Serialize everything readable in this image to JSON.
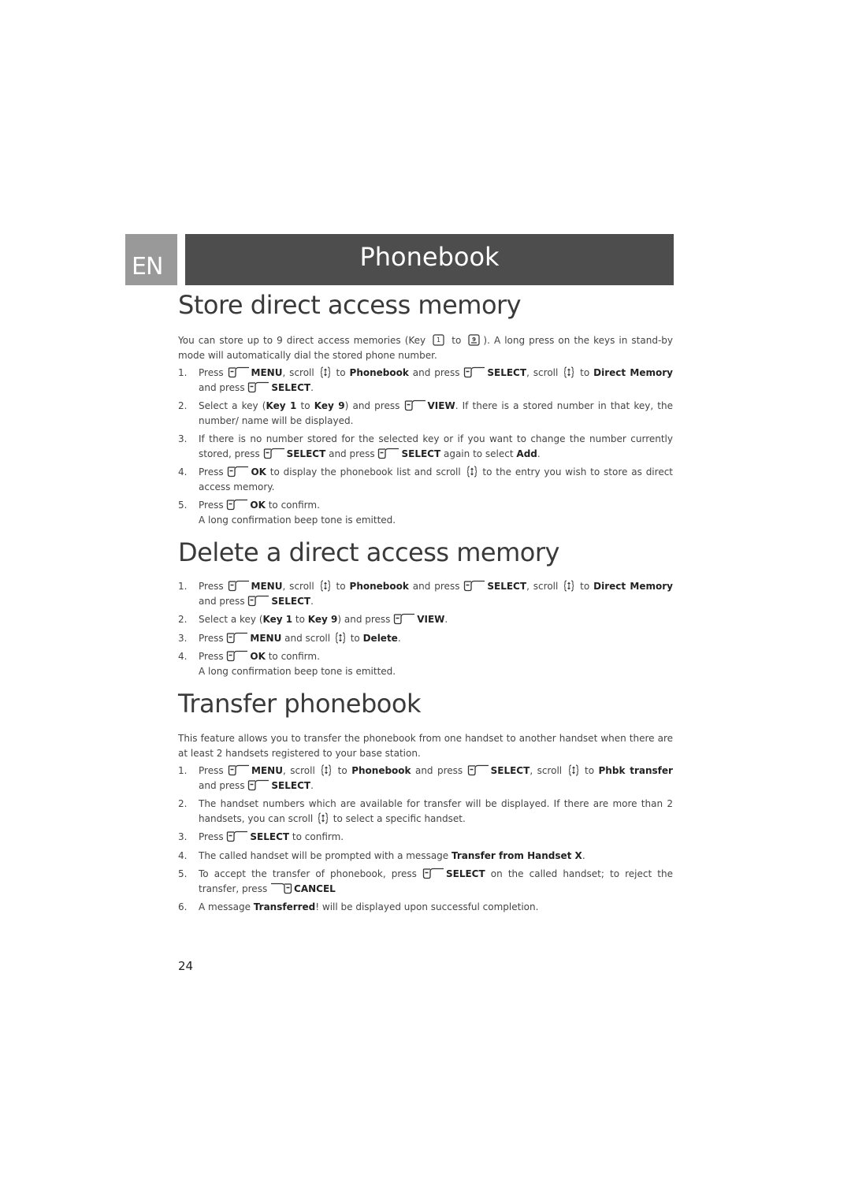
{
  "header": {
    "lang": "EN",
    "title": "Phonebook"
  },
  "sections": [
    {
      "title": "Store direct access memory",
      "intro": {
        "a": "You can store up to 9 direct access memories (Key",
        "to": "to",
        "b": "). A long press on the keys in stand-by mode will automatically dial the stored phone number.",
        "key_first": "1-key-icon",
        "key_last": "9-key-icon"
      },
      "steps": [
        {
          "n": "1.",
          "parts": [
            "Press ",
            "{L}",
            "MENU",
            ", scroll ",
            "{N}",
            " to ",
            "Phonebook",
            " and press ",
            "{L}",
            "SELECT",
            ", scroll ",
            "{N}",
            " to ",
            "Direct Memory",
            " and press ",
            "{L}",
            "SELECT",
            "."
          ]
        },
        {
          "n": "2.",
          "parts": [
            "Select a key (",
            "Key 1",
            " to ",
            "Key 9",
            ") and press ",
            "{L}",
            "VIEW",
            ". If there is a stored number in that key, the number/ name will be displayed."
          ]
        },
        {
          "n": "3.",
          "parts": [
            "If there is no number stored for the selected key or if you want to change the number currently stored, press ",
            "{L}",
            "SELECT",
            " and press ",
            "{L}",
            "SELECT",
            " again to select ",
            "Add",
            "."
          ]
        },
        {
          "n": "4.",
          "parts": [
            "Press ",
            "{L}",
            "OK",
            " to display the phonebook list and scroll ",
            "{N}",
            " to the entry you wish to store as direct access memory."
          ]
        },
        {
          "n": "5.",
          "parts": [
            "Press ",
            "{L}",
            "OK",
            " to confirm.",
            "{BR}",
            "A long confirmation beep tone is emitted."
          ]
        }
      ]
    },
    {
      "title": "Delete a direct access memory",
      "steps": [
        {
          "n": "1.",
          "parts": [
            "Press ",
            "{L}",
            "MENU",
            ", scroll ",
            "{N}",
            " to ",
            "Phonebook",
            " and press ",
            "{L}",
            "SELECT",
            ", scroll ",
            "{N}",
            " to ",
            "Direct Memory",
            " and press ",
            "{L}",
            "SELECT",
            "."
          ]
        },
        {
          "n": "2.",
          "parts": [
            "Select a key (",
            "Key 1",
            " to ",
            "Key 9",
            ") and press ",
            "{L}",
            "VIEW",
            "."
          ]
        },
        {
          "n": "3.",
          "parts": [
            "Press ",
            "{L}",
            "MENU",
            " and scroll ",
            "{N}",
            " to ",
            "Delete",
            "."
          ]
        },
        {
          "n": "4.",
          "parts": [
            "Press ",
            "{L}",
            "OK",
            " to confirm.",
            "{BR}",
            "A long confirmation beep tone is emitted."
          ]
        }
      ]
    },
    {
      "title": "Transfer phonebook",
      "intro_text": "This feature allows you to transfer the phonebook from one handset to another handset when there are at least 2 handsets registered to your base station.",
      "steps": [
        {
          "n": "1.",
          "parts": [
            "Press ",
            "{L}",
            "MENU",
            ", scroll ",
            "{N}",
            " to ",
            "Phonebook",
            " and press ",
            "{L}",
            "SELECT",
            ", scroll ",
            "{N}",
            " to ",
            "Phbk transfer",
            " and press ",
            "{L}",
            "SELECT",
            "."
          ]
        },
        {
          "n": "2.",
          "parts": [
            "The handset numbers which are available for transfer will be displayed. If there are more than 2 handsets, you can scroll ",
            "{N}",
            " to select a specific handset."
          ]
        },
        {
          "n": "3.",
          "parts": [
            "Press ",
            "{L}",
            "SELECT",
            " to confirm."
          ]
        },
        {
          "n": "4.",
          "parts": [
            "The called handset will be prompted with a message ",
            "Transfer from Handset X",
            "."
          ]
        },
        {
          "n": "5.",
          "parts": [
            "To accept the transfer of phonebook, press ",
            "{L}",
            "SELECT",
            " on the called handset; to reject the transfer, press ",
            "{R}",
            "CANCEL"
          ]
        },
        {
          "n": "6.",
          "parts": [
            "A message ",
            "Transferred",
            "! will be displayed upon successful completion."
          ]
        }
      ]
    }
  ],
  "bold_terms": [
    "MENU",
    "SELECT",
    "VIEW",
    "OK",
    "CANCEL",
    "Phonebook",
    "Direct Memory",
    "Key 1",
    "Key 9",
    "Add",
    "Delete",
    "Phbk transfer",
    "Transfer from Handset X",
    "Transferred"
  ],
  "page_number": "24"
}
